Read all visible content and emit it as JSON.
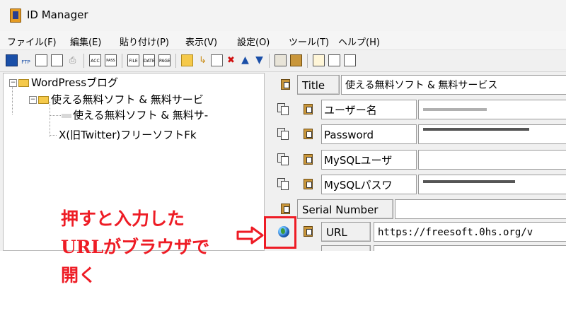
{
  "window": {
    "title": "ID Manager"
  },
  "menu": [
    "ファイル(F)",
    "編集(E)",
    "貼り付け(P)",
    "表示(V)",
    "設定(O)",
    "ツール(T)",
    "ヘルプ(H)"
  ],
  "toolbar": {
    "ftp_label": "FTP",
    "acc_label": "ACC",
    "pass_label": "PASS",
    "file_label": "FILE",
    "date_label": "DATE",
    "page_label": "PAGE"
  },
  "tree": {
    "root": "WordPressブログ",
    "child": "使える無料ソフト & 無料サービ",
    "leaf1": "使える無料ソフト & 無料サ-",
    "leaf2": "X(旧Twitter)フリーソフトFk"
  },
  "fields": {
    "title": {
      "label": "Title",
      "value": "使える無料ソフト & 無料サービス"
    },
    "username": {
      "label": "ユーザー名",
      "value": ""
    },
    "password": {
      "label": "Password",
      "value": ""
    },
    "mysql_user": {
      "label": "MySQLユーザ",
      "value": ""
    },
    "mysql_pass": {
      "label": "MySQLパスワ",
      "value": ""
    },
    "serial": {
      "label": "Serial Number",
      "value": ""
    },
    "url": {
      "label": "URL",
      "value": "https://freesoft.0hs.org/v"
    }
  },
  "annotation": {
    "line1": "押すと入力した",
    "line2": "URLがブラウザで",
    "line3": "開く"
  },
  "colors": {
    "annotation": "#ee1c25",
    "folder": "#f5c94a"
  }
}
